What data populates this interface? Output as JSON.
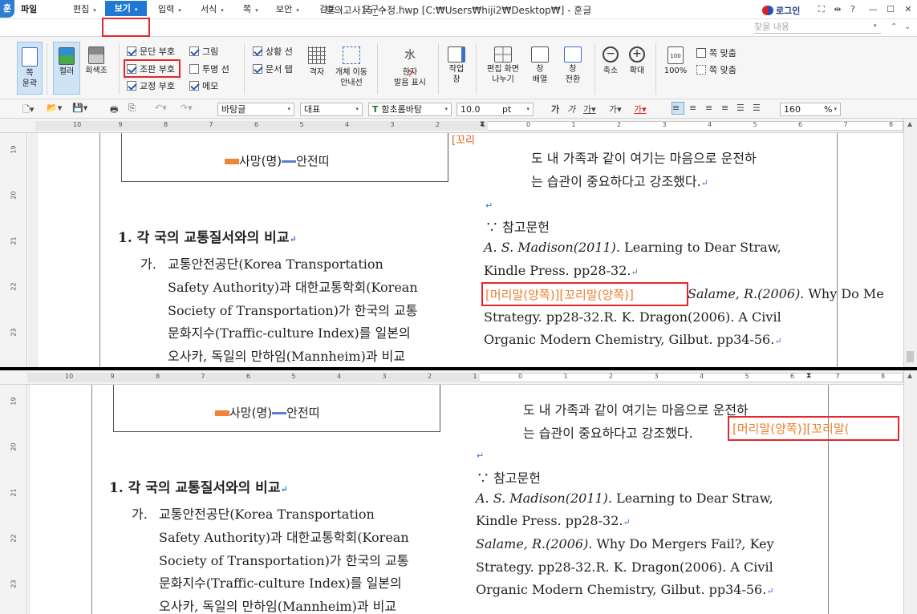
{
  "titlebar": {
    "app_logo": "훈",
    "title": "모의고사15_수정.hwp [C:₩Users₩hiji2₩Desktop₩] - 훈글",
    "login": "로그인"
  },
  "menubar": {
    "items": [
      "파일",
      "편집",
      "보기",
      "입력",
      "서식",
      "쪽",
      "보안",
      "검토",
      "도구"
    ],
    "search_placeholder": "찾을 내용"
  },
  "ribbon": {
    "page_outline": "쪽\n윤곽",
    "color": "컬러",
    "grayscale": "회색조",
    "checks": [
      {
        "label": "문단 부호",
        "checked": true
      },
      {
        "label": "조판 부호",
        "checked": true
      },
      {
        "label": "교정 부호",
        "checked": true
      },
      {
        "label": "그림",
        "checked": true
      },
      {
        "label": "투명 선",
        "checked": false
      },
      {
        "label": "메모",
        "checked": true
      },
      {
        "label": "상황 선",
        "checked": true
      },
      {
        "label": "문서 탭",
        "checked": true
      }
    ],
    "grid": "격자",
    "object_move": "개체 이동\n안내선",
    "hanja": "한자\n발음 표시",
    "task_window": "작업\n창",
    "split": "편집 화면\n나누기",
    "arrange": "창\n배열",
    "switch": "창\n전환",
    "zoom_out": "축소",
    "zoom_in": "확대",
    "zoom_100": "100%",
    "fit_page": "쪽 맞춤",
    "fit_width": "쪽 맞춤"
  },
  "toolbar2": {
    "style": "바탕글",
    "lang": "대표",
    "font": "함초롬바탕",
    "size": "10.0",
    "unit": "pt",
    "zoom": "160",
    "zoom_unit": "%"
  },
  "ruler_numbers": [
    "10",
    "9",
    "8",
    "7",
    "6",
    "5",
    "4",
    "3",
    "2",
    "1",
    "0",
    "1",
    "2",
    "3",
    "4",
    "5",
    "6",
    "7",
    "8",
    "9"
  ],
  "vruler_top": [
    "19",
    "20",
    "21",
    "22",
    "23"
  ],
  "vruler_bottom": [
    "19",
    "20",
    "21",
    "22",
    "23"
  ],
  "doc": {
    "legend_a": "사망(명)",
    "legend_b": "안전띠",
    "heading": "1. 각 국의 교통질서와의 비교",
    "para_ga": "가.",
    "left_lines": [
      "교통안전공단(Korea          Transportation",
      "Safety Authority)과 대한교통학회(Korean",
      "Society of Transportation)가 한국의 교통",
      "문화지수(Traffic-culture  Index)를  일본의",
      "오사카,  독일의  만하임(Mannheim)과  비교"
    ],
    "right_top_1": "도 내 가족과 같이 여기는 마음으로 운전하",
    "right_top_2": "는 습관이 중요하다고 강조했다.",
    "ref_title": "∵ 참고문헌",
    "ref_1a": "A. S. Madison(2011).",
    "ref_1b": " Learning to Dear Straw,",
    "ref_2": "Kindle Press. pp28-32.",
    "ref_3a": "Salame, R.(2006).",
    "ref_3b": " Why Do Mergers Fail?, Key",
    "ref_3b_top": " Why Do Me",
    "ref_4": "Strategy. pp28-32.R. K. Dragon(2006). A Civil",
    "ref_5": "Organic Modern Chemistry, Gilbut. pp34-56.",
    "marker": "[머리말(양쪽)][꼬리말(양쪽)]",
    "marker_cut": "[머리말(양쪽)][꼬리말(",
    "marker_small": "[꼬리"
  },
  "colors": {
    "accent": "#1f78d1",
    "highlight": "#e5262b",
    "legend_a": "#f0853a",
    "legend_b": "#5a7fd0"
  }
}
